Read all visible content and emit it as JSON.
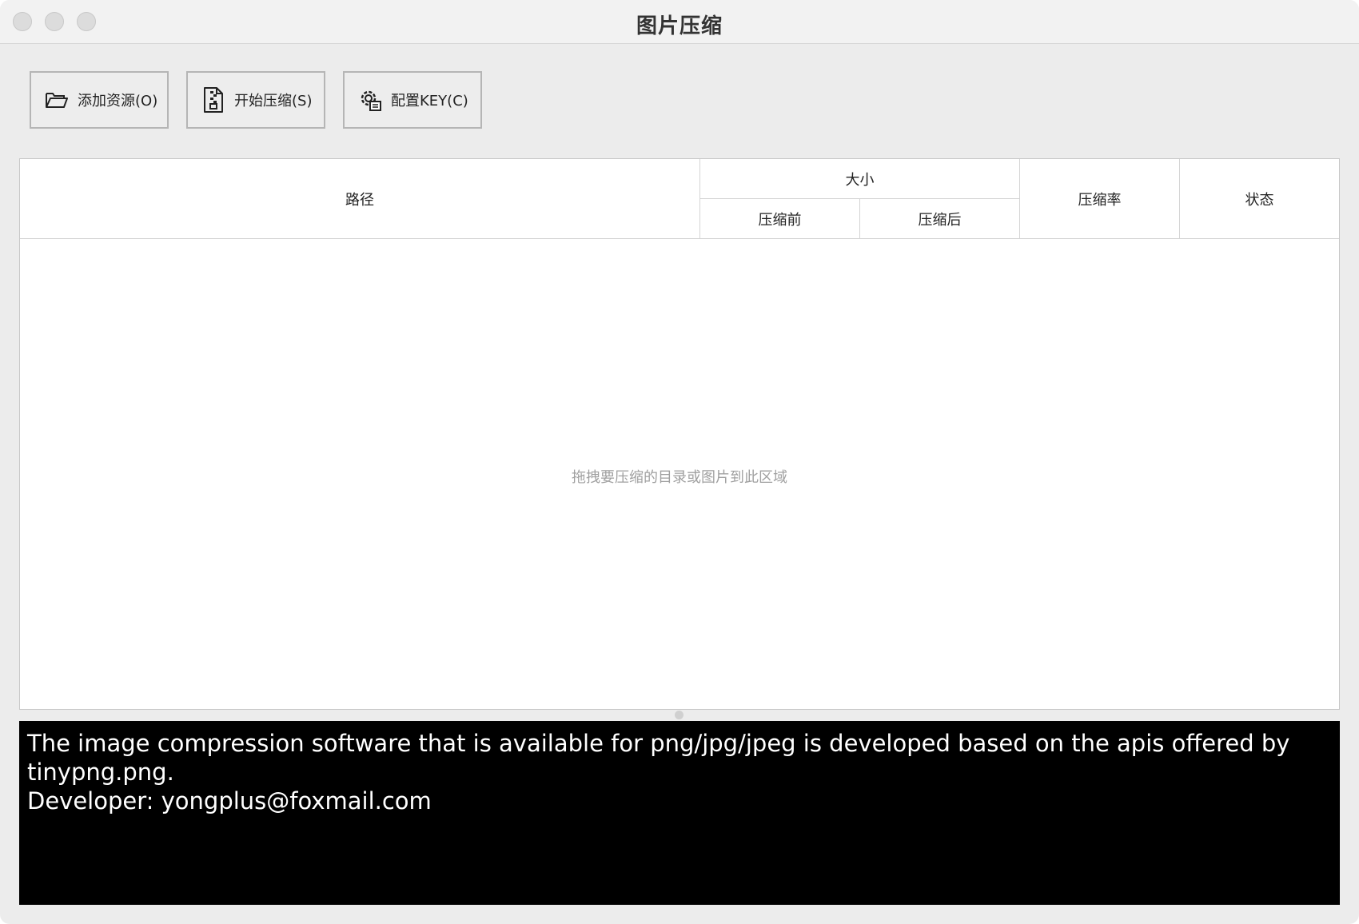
{
  "window": {
    "title": "图片压缩"
  },
  "toolbar": {
    "add_label": "添加资源(O)",
    "start_label": "开始压缩(S)",
    "key_label": "配置KEY(C)",
    "add_icon": "folder-open-icon",
    "start_icon": "zip-file-icon",
    "key_icon": "settings-gear-icon"
  },
  "table": {
    "headers": {
      "path": "路径",
      "size": "大小",
      "before": "压缩前",
      "after": "压缩后",
      "ratio": "压缩率",
      "status": "状态"
    },
    "empty_hint": "拖拽要压缩的目录或图片到此区域",
    "rows": []
  },
  "console": {
    "lines": [
      "The image compression software that is available for png/jpg/jpeg is developed based on the apis offered by tinypng.png.",
      "Developer: yongplus@foxmail.com"
    ]
  },
  "colors": {
    "window_bg": "#ececec",
    "console_bg": "#000000",
    "console_text": "#ffffff",
    "hint_text": "#a0a0a0"
  }
}
